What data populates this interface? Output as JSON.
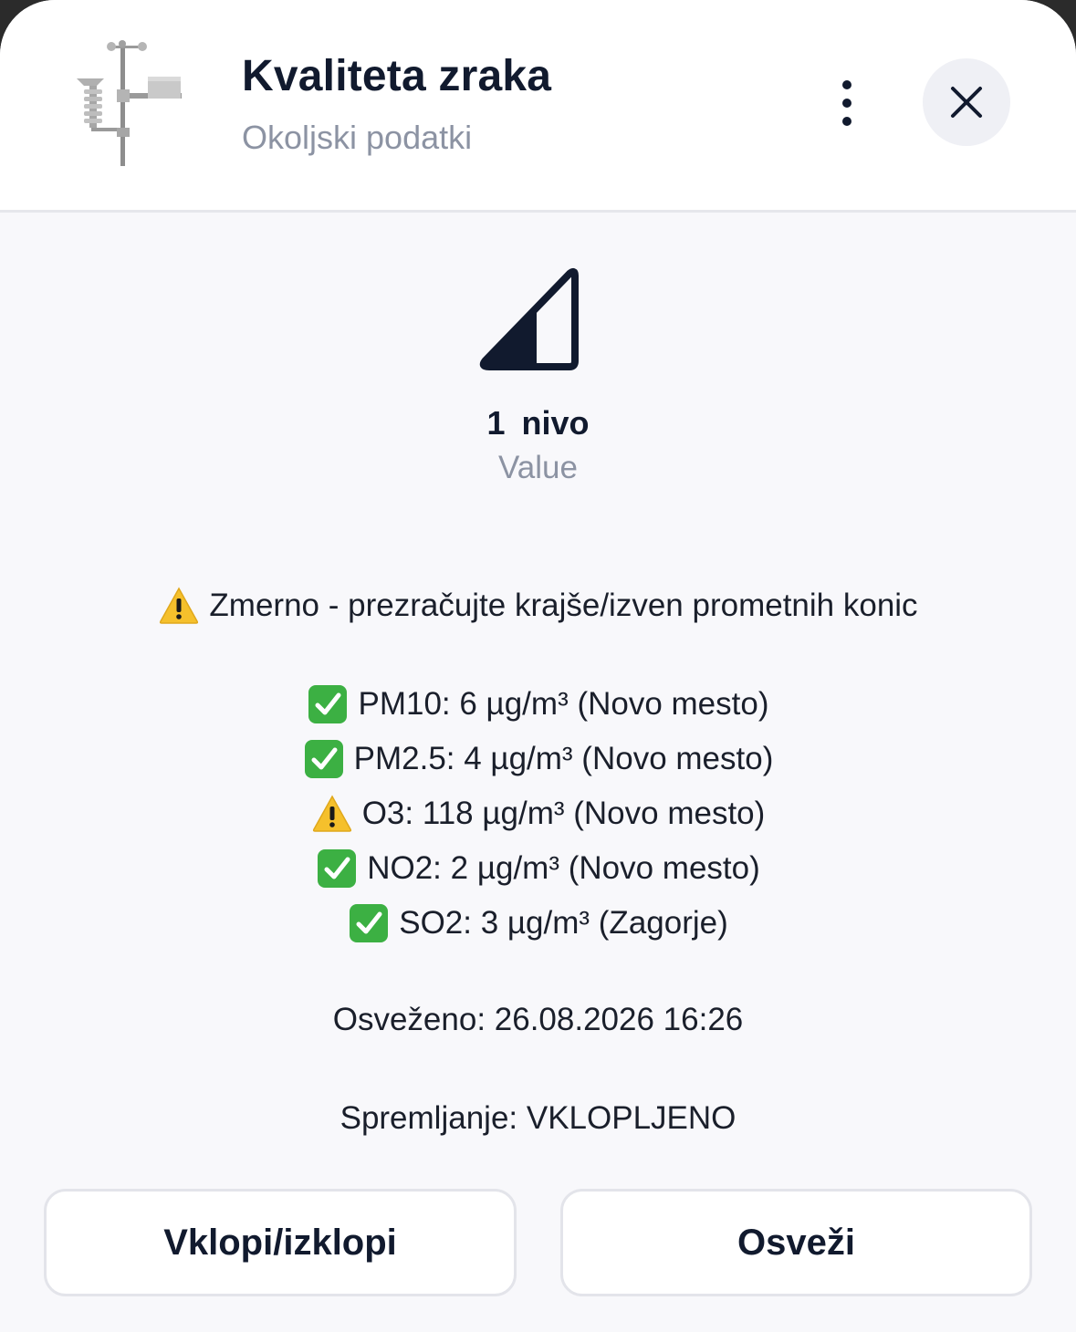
{
  "header": {
    "title": "Kvaliteta zraka",
    "subtitle": "Okoljski podatki",
    "device_icon": "weather-station-icon",
    "more_icon": "more-vertical-icon",
    "close_icon": "close-icon"
  },
  "level": {
    "icon": "signal-level-icon",
    "value": "1",
    "unit": "nivo",
    "label": "Value"
  },
  "status": {
    "icon": "warning-icon",
    "text": "Zmerno - prezračujte krajše/izven prometnih konic"
  },
  "pollutants": [
    {
      "icon": "check-icon",
      "text": "PM10: 6 µg/m³ (Novo mesto)"
    },
    {
      "icon": "check-icon",
      "text": "PM2.5: 4 µg/m³ (Novo mesto)"
    },
    {
      "icon": "warning-icon",
      "text": "O3: 118 µg/m³ (Novo mesto)"
    },
    {
      "icon": "check-icon",
      "text": "NO2: 2 µg/m³ (Novo mesto)"
    },
    {
      "icon": "check-icon",
      "text": "SO2: 3 µg/m³ (Zagorje)"
    }
  ],
  "refreshed": "Osveženo: 26.08.2026 16:26",
  "storage": "Spremljanje: VKLOPLJENO",
  "buttons": {
    "toggle": "Vklopi/izklopi",
    "refresh": "Osveži"
  },
  "colors": {
    "title": "#111a2e",
    "muted": "#8c93a3",
    "check_green": "#3cb043",
    "warning_yellow": "#f5c02c"
  }
}
